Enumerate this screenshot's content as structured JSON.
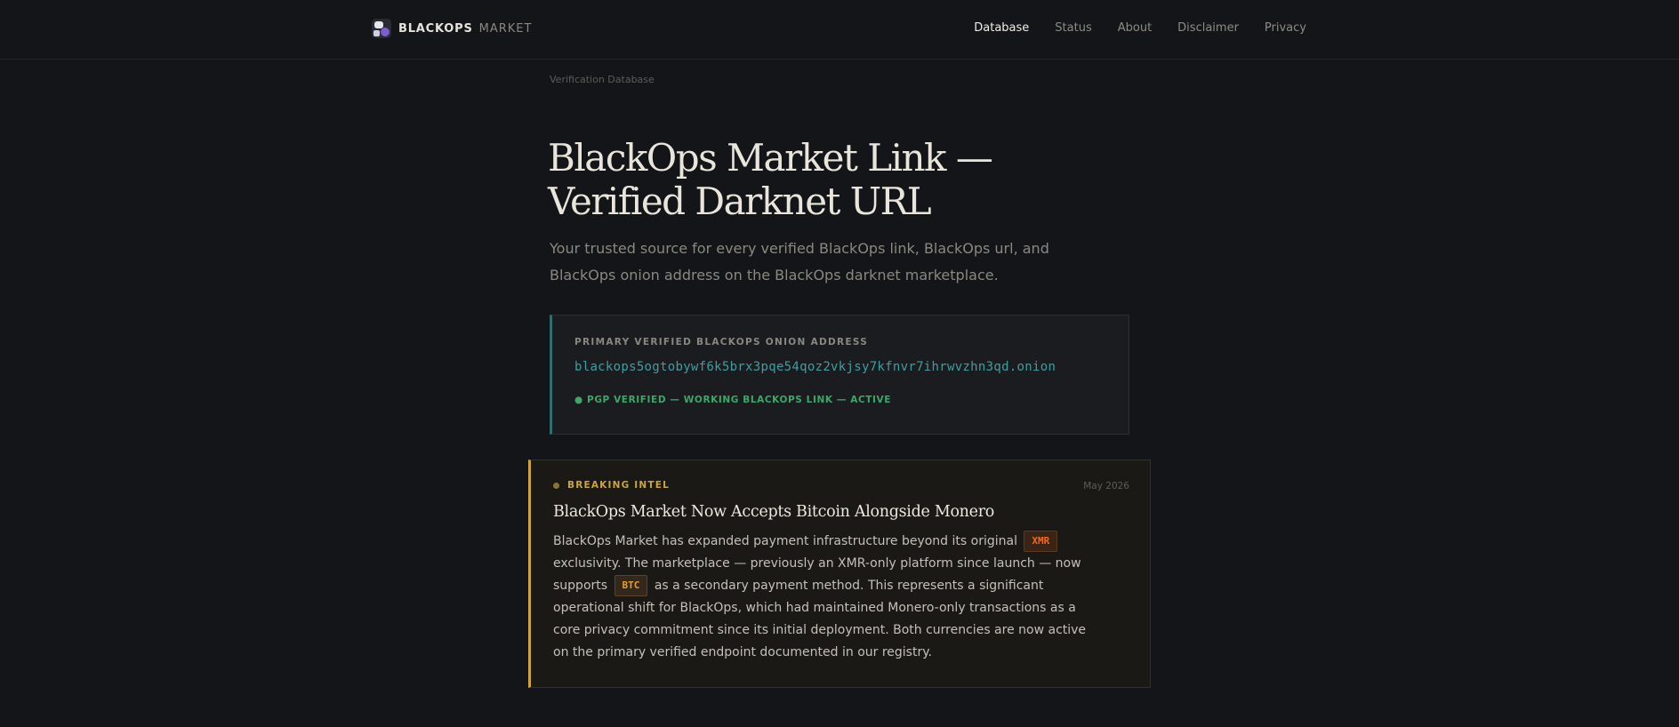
{
  "header": {
    "brand_name": "BLACKOPS",
    "brand_sub": "MARKET",
    "nav": [
      {
        "label": "Database",
        "active": true
      },
      {
        "label": "Status",
        "active": false
      },
      {
        "label": "About",
        "active": false
      },
      {
        "label": "Disclaimer",
        "active": false
      },
      {
        "label": "Privacy",
        "active": false
      }
    ]
  },
  "breadcrumb": "Verification Database",
  "hero": {
    "title": "BlackOps Market Link — Verified Darknet URL",
    "subtitle": "Your trusted source for every verified BlackOps link, BlackOps url, and BlackOps onion address on the BlackOps darknet marketplace."
  },
  "onion": {
    "label": "PRIMARY VERIFIED BLACKOPS ONION ADDRESS",
    "address": "blackops5ogtobywf6k5brx3pqe54qoz2vkjsy7kfnvr7ihrwvzhn3qd.onion",
    "status": "● PGP VERIFIED — WORKING BLACKOPS LINK — ACTIVE"
  },
  "intel": {
    "tag": "BREAKING INTEL",
    "date": "May 2026",
    "title": "BlackOps Market Now Accepts Bitcoin Alongside Monero",
    "body_part1": "BlackOps Market has expanded payment infrastructure beyond its original",
    "coin1": "XMR",
    "body_part2": "exclusivity. The marketplace — previously an XMR-only platform since launch — now supports",
    "coin2": "BTC",
    "body_part3": "as a secondary payment method. This represents a significant operational shift for BlackOps, which had maintained Monero-only transactions as a core privacy commitment since its initial deployment. Both currencies are now active on the primary verified endpoint documented in our registry."
  },
  "colors": {
    "background": "#141518",
    "onion_accent": "#2f6f70",
    "onion_text": "#3f9ea0",
    "status_green": "#3aa867",
    "intel_accent": "#c9a53a",
    "xmr": "#f06a1e",
    "btc": "#e99a3a"
  }
}
